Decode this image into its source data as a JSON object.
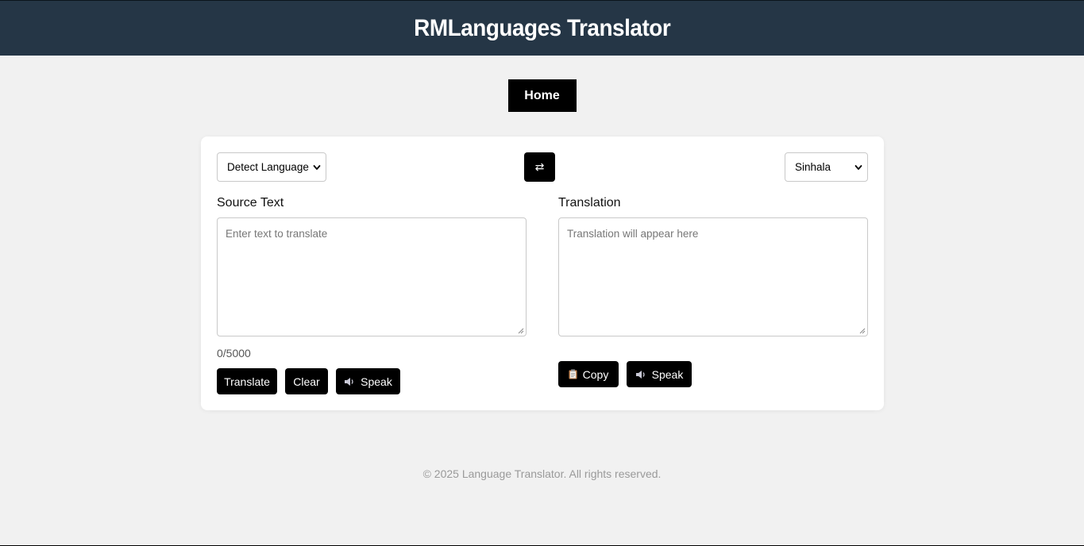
{
  "header": {
    "title": "RMLanguages Translator"
  },
  "nav": {
    "home_label": "Home"
  },
  "translator": {
    "source_language": {
      "selected": "Detect Language"
    },
    "target_language": {
      "selected": "Sinhala"
    },
    "swap_icon": "⇄",
    "source": {
      "label": "Source Text",
      "placeholder": "Enter text to translate",
      "value": "",
      "char_count": "0/5000"
    },
    "target": {
      "label": "Translation",
      "placeholder": "Translation will appear here",
      "value": ""
    },
    "buttons": {
      "translate": "Translate",
      "clear": "Clear",
      "speak_source": "Speak",
      "copy": "Copy",
      "speak_target": "Speak"
    },
    "icons": {
      "speaker": "speaker-icon",
      "clipboard": "clipboard-icon",
      "swap": "swap-icon"
    }
  },
  "footer": {
    "text": "© 2025 Language Translator. All rights reserved."
  },
  "colors": {
    "header_bg": "#253646",
    "page_bg": "#f1f1f1",
    "button_bg": "#000000",
    "card_bg": "#ffffff"
  }
}
